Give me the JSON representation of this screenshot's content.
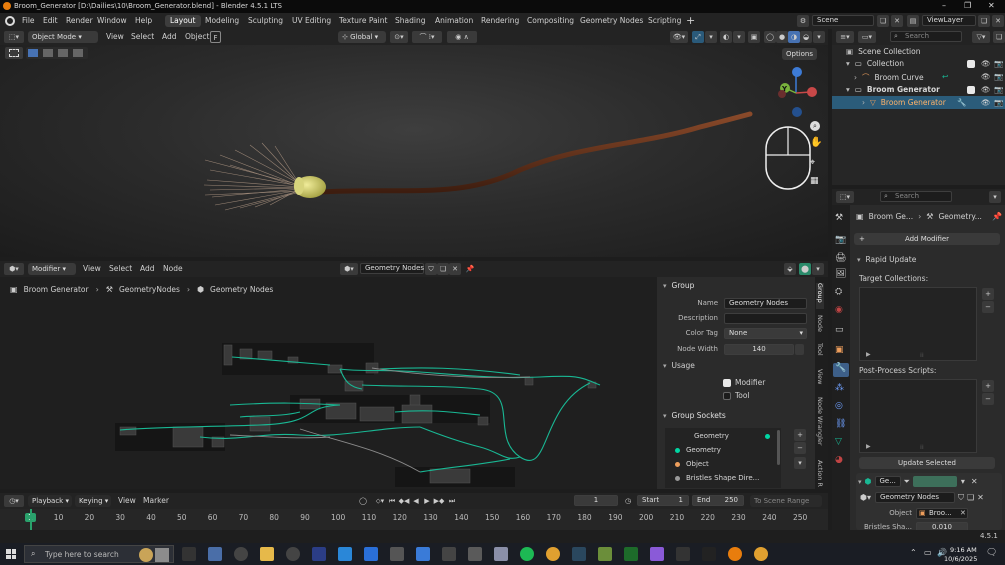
{
  "window": {
    "title": "Broom_Generator [D:\\Dailies\\10\\Broom_Generator.blend] - Blender 4.5.1 LTS"
  },
  "menu": [
    "File",
    "Edit",
    "Render",
    "Window",
    "Help"
  ],
  "workspaces": [
    "Layout",
    "Modeling",
    "Sculpting",
    "UV Editing",
    "Texture Paint",
    "Shading",
    "Animation",
    "Rendering",
    "Compositing",
    "Geometry Nodes",
    "Scripting"
  ],
  "active_workspace": "Layout",
  "scene": "Scene",
  "view_layer": "ViewLayer",
  "viewport_header": {
    "mode": "Object Mode",
    "menus": [
      "View",
      "Select",
      "Add",
      "Object"
    ],
    "transform_orientation": "Global",
    "options": "Options",
    "shortcut_hint": "F"
  },
  "gizmo": {
    "y": "Y"
  },
  "outliner": {
    "search_placeholder": "Search",
    "items": [
      {
        "label": "Scene Collection"
      },
      {
        "label": "Collection"
      },
      {
        "label": "Broom Curve"
      },
      {
        "label": "Broom Generator"
      },
      {
        "label": "Broom Generator"
      }
    ]
  },
  "node_editor": {
    "editor": "Modifier",
    "menus": [
      "View",
      "Select",
      "Add",
      "Node"
    ],
    "tree_name": "Geometry Nodes",
    "breadcrumb": [
      "Broom Generator",
      "GeometryNodes",
      "Geometry Nodes"
    ]
  },
  "npanel": {
    "group_title": "Group",
    "name_label": "Name",
    "name_value": "Geometry Nodes",
    "description_label": "Description",
    "description_value": "",
    "color_tag_label": "Color Tag",
    "color_tag_value": "None",
    "node_width_label": "Node Width",
    "node_width_value": "140",
    "usage_title": "Usage",
    "usage_options": [
      {
        "label": "Modifier",
        "checked": true
      },
      {
        "label": "Tool",
        "checked": false
      }
    ],
    "sockets_title": "Group Sockets",
    "sockets": [
      {
        "label": "Geometry",
        "color": "#00d6a3"
      },
      {
        "label": "Geometry",
        "color": "#00d6a3"
      },
      {
        "label": "Object",
        "color": "#ed9e5c"
      },
      {
        "label": "Bristles Shape Dire...",
        "color": "#9a9a9a"
      }
    ],
    "tabs": [
      "Group",
      "Node",
      "Tool",
      "View",
      "Node Wrangler",
      "Action R"
    ]
  },
  "properties": {
    "search_placeholder": "Search",
    "object_name": "Broom Ge...",
    "modifier_name": "Geometry...",
    "add_modifier": "Add Modifier",
    "rapid_update": "Rapid Update",
    "target_collections": "Target Collections:",
    "post_process": "Post-Process Scripts:",
    "update_selected": "Update Selected",
    "mod_short": "Ge...",
    "mod_tree": "Geometry Nodes",
    "object_label": "Object",
    "object_value": "Broo...",
    "bristles_label": "Bristles Sha...",
    "bristles_value": "0.010"
  },
  "timeline": {
    "menus": [
      "Playback",
      "Keying",
      "View",
      "Marker"
    ],
    "current_frame": "1",
    "start_label": "Start",
    "start": "1",
    "end_label": "End",
    "end": "250",
    "to_scene_range": "To Scene Range",
    "ticks": [
      "1",
      "10",
      "20",
      "30",
      "40",
      "50",
      "60",
      "70",
      "80",
      "90",
      "100",
      "110",
      "120",
      "130",
      "140",
      "150",
      "160",
      "170",
      "180",
      "190",
      "200",
      "210",
      "220",
      "230",
      "240",
      "250"
    ]
  },
  "version": "4.5.1",
  "taskbar": {
    "search_placeholder": "Type here to search",
    "time": "9:16 AM",
    "date": "10/6/2025"
  },
  "colors": {
    "accent_green": "#00d6a3",
    "active_blue": "#4772b3",
    "node_wire": "#19b894",
    "timeline_green": "#2aa16c"
  }
}
